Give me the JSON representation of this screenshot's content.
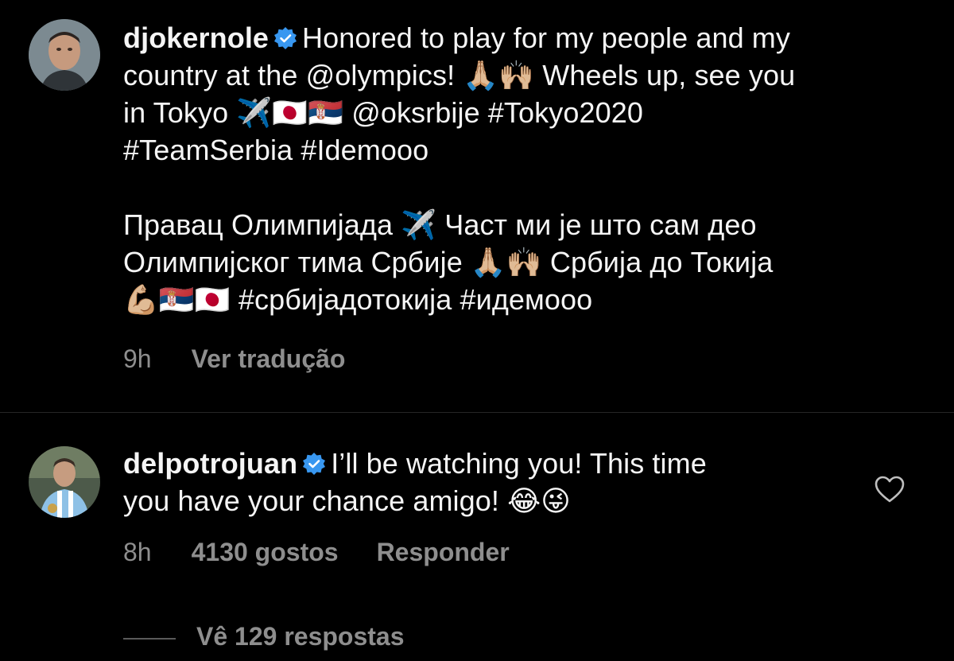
{
  "colors": {
    "background": "#000000",
    "text": "#f5f5f5",
    "muted": "#8e8e8e",
    "verified": "#3897f0",
    "divider": "#262626"
  },
  "post": {
    "username": "djokernole",
    "verified_icon": "verified-badge-icon",
    "lines": [
      "Honored to play for my people and my",
      "country at the @olympics! 🙏🏼🙌🏼 Wheels up, see you",
      "in Tokyo ✈️🇯🇵🇷🇸 @oksrbije #Tokyo2020",
      "#TeamSerbia #Idemooo",
      "",
      "Правац Олимпијада ✈️ Част ми је што сам део",
      "Олимпијског тима Србије 🙏🏼🙌🏼 Србија до Токија",
      "💪🏼🇷🇸🇯🇵 #србијадотокија #идемооо"
    ],
    "time": "9h",
    "translate": "Ver tradução"
  },
  "comment": {
    "username": "delpotrojuan",
    "verified_icon": "verified-badge-icon",
    "line1": "I’ll be watching you! This time",
    "line2": "you have your chance amigo! 😂😜",
    "time": "8h",
    "likes": "4130 gostos",
    "reply": "Responder",
    "view_replies": "Vê 129 respostas",
    "like_icon": "heart-outline-icon"
  }
}
